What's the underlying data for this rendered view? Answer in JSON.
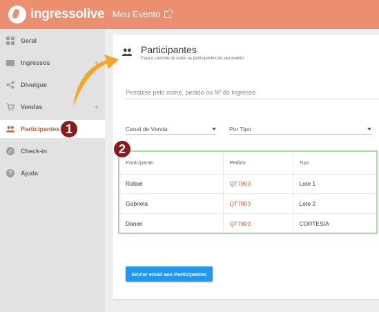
{
  "header": {
    "logo_text": "ingressolive",
    "event_title": "Meu Evento"
  },
  "sidebar": {
    "items": [
      {
        "label": "Geral"
      },
      {
        "label": "Ingressos",
        "expand": "+"
      },
      {
        "label": "Divulgue"
      },
      {
        "label": "Vendas",
        "expand": "+"
      },
      {
        "label": "Participantes"
      },
      {
        "label": "Check-in"
      },
      {
        "label": "Ajuda"
      }
    ]
  },
  "annotations": {
    "badge1": "1",
    "badge2": "2"
  },
  "main": {
    "title": "Participantes",
    "subtitle": "Faça o controle de todos os participantes do seu evento",
    "search_placeholder": "Pesquise pelo nome, pedido ou Nº do Ingresso",
    "filters": {
      "canal": "Canal de Venda",
      "tipo": "Por Tipo"
    },
    "table": {
      "headers": [
        "Participante",
        "Pedido",
        "Tipo"
      ],
      "rows": [
        {
          "participante": "Rafael",
          "pedido": "QT7803",
          "tipo": "Lote 1"
        },
        {
          "participante": "Gabriela",
          "pedido": "QT7803",
          "tipo": "Lote 2"
        },
        {
          "participante": "Daniel",
          "pedido": "QT7803",
          "tipo": "CORTESIA"
        }
      ]
    },
    "email_button": "Enviar email aos Participantes"
  },
  "colors": {
    "header": "#ec8f70",
    "accent": "#e3572e",
    "button": "#2196f3",
    "highlight_border": "#aad9a4",
    "arrow": "#f5a623",
    "badge": "#8b1a1a"
  }
}
